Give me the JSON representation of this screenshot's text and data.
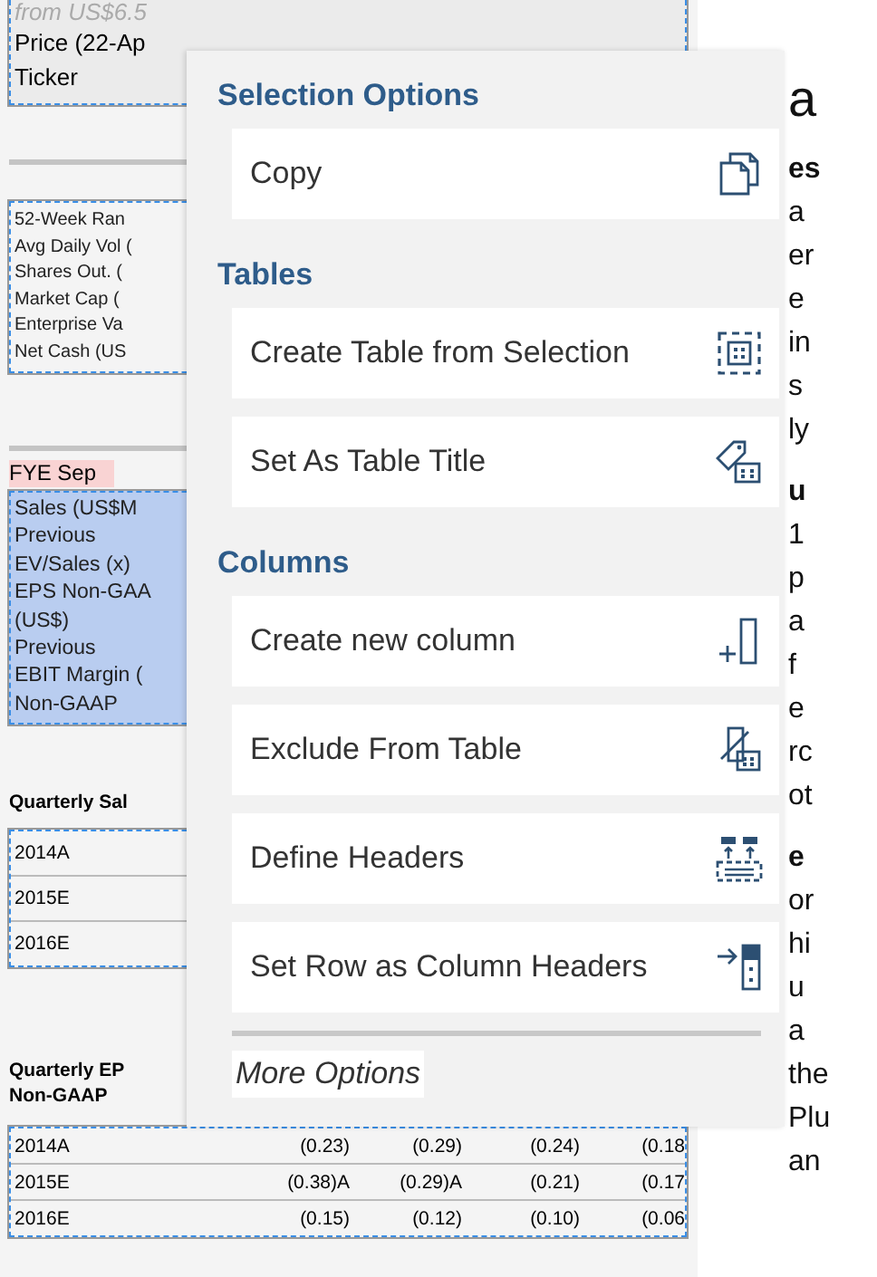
{
  "document": {
    "summary_box": {
      "selected": false,
      "note": "from US$6.5",
      "rows": [
        "Price (22-Ap",
        "Ticker"
      ]
    },
    "stats_box": {
      "selected": false,
      "rows": [
        "52-Week Ran",
        "Avg Daily Vol (",
        "Shares Out. (",
        "Market Cap  (",
        "Enterprise Va",
        "Net Cash  (US"
      ]
    },
    "fye_label": "FYE Sep",
    "estimates_box": {
      "selected": true,
      "rows": [
        "Sales  (US$M",
        "Previous",
        "EV/Sales (x)",
        "EPS  Non-GAA",
        "(US$)",
        "Previous",
        "EBIT Margin (",
        "Non-GAAP"
      ]
    },
    "quarterly_sales": {
      "title_lines": [
        "Quarterly Sal"
      ],
      "selected": false,
      "rows": [
        {
          "label": "2014A",
          "values": []
        },
        {
          "label": "2015E",
          "values": []
        },
        {
          "label": "2016E",
          "values": []
        }
      ]
    },
    "quarterly_eps": {
      "title_lines": [
        "Quarterly EP",
        "Non-GAAP"
      ],
      "selected": false,
      "rows": [
        {
          "label": "2014A",
          "values": [
            "(0.23)",
            "(0.29)",
            "(0.24)",
            "(0.18"
          ]
        },
        {
          "label": "2015E",
          "values": [
            "(0.38)A",
            "(0.29)A",
            "(0.21)",
            "(0.17"
          ]
        },
        {
          "label": "2016E",
          "values": [
            "(0.15)",
            "(0.12)",
            "(0.10)",
            "(0.06"
          ]
        }
      ]
    },
    "right_column": [
      {
        "kind": "heading",
        "text": "a"
      },
      {
        "kind": "bold",
        "text": "es"
      },
      {
        "kind": "text",
        "text": "a"
      },
      {
        "kind": "text",
        "text": "er"
      },
      {
        "kind": "text",
        "text": "e"
      },
      {
        "kind": "text",
        "text": "in"
      },
      {
        "kind": "text",
        "text": "s"
      },
      {
        "kind": "text",
        "text": "ly"
      },
      {
        "kind": "bold",
        "text": "u"
      },
      {
        "kind": "text",
        "text": "1"
      },
      {
        "kind": "text",
        "text": "p"
      },
      {
        "kind": "text",
        "text": "a"
      },
      {
        "kind": "text",
        "text": "f"
      },
      {
        "kind": "text",
        "text": "e"
      },
      {
        "kind": "text",
        "text": "rc"
      },
      {
        "kind": "text",
        "text": "ot"
      },
      {
        "kind": "bold",
        "text": "e"
      },
      {
        "kind": "text",
        "text": "or"
      },
      {
        "kind": "text",
        "text": "hi"
      },
      {
        "kind": "text",
        "text": "u"
      },
      {
        "kind": "text",
        "text": "a"
      },
      {
        "kind": "text",
        "text": "the"
      },
      {
        "kind": "text",
        "text": "Plu"
      },
      {
        "kind": "text",
        "text": "an"
      }
    ]
  },
  "menu": {
    "sections": [
      {
        "title": "Selection Options",
        "items": [
          {
            "label": "Copy",
            "kind": "copy"
          }
        ]
      },
      {
        "title": "Tables",
        "items": [
          {
            "label": "Create Table from Selection",
            "kind": "create"
          },
          {
            "label": "Set As Table Title",
            "kind": "title"
          }
        ]
      },
      {
        "title": "Columns",
        "items": [
          {
            "label": "Create new column",
            "kind": "add"
          },
          {
            "label": "Exclude From Table",
            "kind": "exclude"
          },
          {
            "label": "Define Headers",
            "kind": "headers"
          },
          {
            "label": "Set Row as Column Headers",
            "kind": "rowheaders"
          }
        ]
      }
    ],
    "more_options": "More Options"
  }
}
